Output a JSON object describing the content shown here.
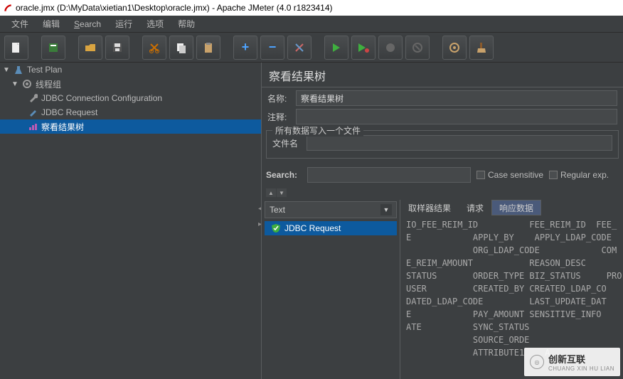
{
  "window": {
    "title": "oracle.jmx (D:\\MyData\\xietian1\\Desktop\\oracle.jmx) - Apache JMeter (4.0 r1823414)"
  },
  "menu": {
    "file": "文件",
    "edit": "编辑",
    "search": "Search",
    "run": "运行",
    "options": "选项",
    "help": "帮助"
  },
  "toolbar_icons": {
    "new": "new",
    "open": "open",
    "save": "save",
    "savetpl": "savetpl",
    "cut": "cut",
    "copy": "copy",
    "paste": "paste",
    "add": "add",
    "remove": "remove",
    "wand": "wand",
    "start": "start",
    "start_no": "start_no",
    "stop": "stop",
    "shutdown": "shutdown",
    "gear": "gear",
    "broom": "broom"
  },
  "tree": {
    "test_plan": "Test Plan",
    "thread_group": "线程组",
    "jdbc_conn": "JDBC Connection Configuration",
    "jdbc_req": "JDBC Request",
    "view_results": "察看结果树"
  },
  "panel": {
    "title": "察看结果树",
    "name_label": "名称:",
    "name_value": "察看结果树",
    "comment_label": "注释:",
    "comment_value": "",
    "write_all_legend": "所有数据写入一个文件",
    "filename_label": "文件名",
    "filename_value": "",
    "search_label": "Search:",
    "search_value": "",
    "case_sensitive": "Case sensitive",
    "regular_exp": "Regular exp."
  },
  "results": {
    "dropdown": "Text",
    "sample": "JDBC Request",
    "tabs": {
      "sampler": "取样器结果",
      "request": "请求",
      "response": "响应数据"
    },
    "response_lines": [
      "IO_FEE_REIM_ID          FEE_REIM_ID  FEE_",
      "E            APPLY_BY    APPLY_LDAP_CODE",
      "             ORG_LDAP_CODE            COM",
      "E_REIM_AMOUNT           REASON_DESC",
      "STATUS       ORDER_TYPE BIZ_STATUS     PRO",
      "USER         CREATED_BY CREATED_LDAP_CO",
      "DATED_LDAP_CODE         LAST_UPDATE_DAT",
      "E            PAY_AMOUNT SENSITIVE_INFO",
      "ATE          SYNC_STATUS",
      "             SOURCE_ORDE",
      "             ATTRIBUTE1    A"
    ]
  },
  "watermark": {
    "text": "创新互联",
    "sub": "CHUANG XIN HU LIAN"
  }
}
